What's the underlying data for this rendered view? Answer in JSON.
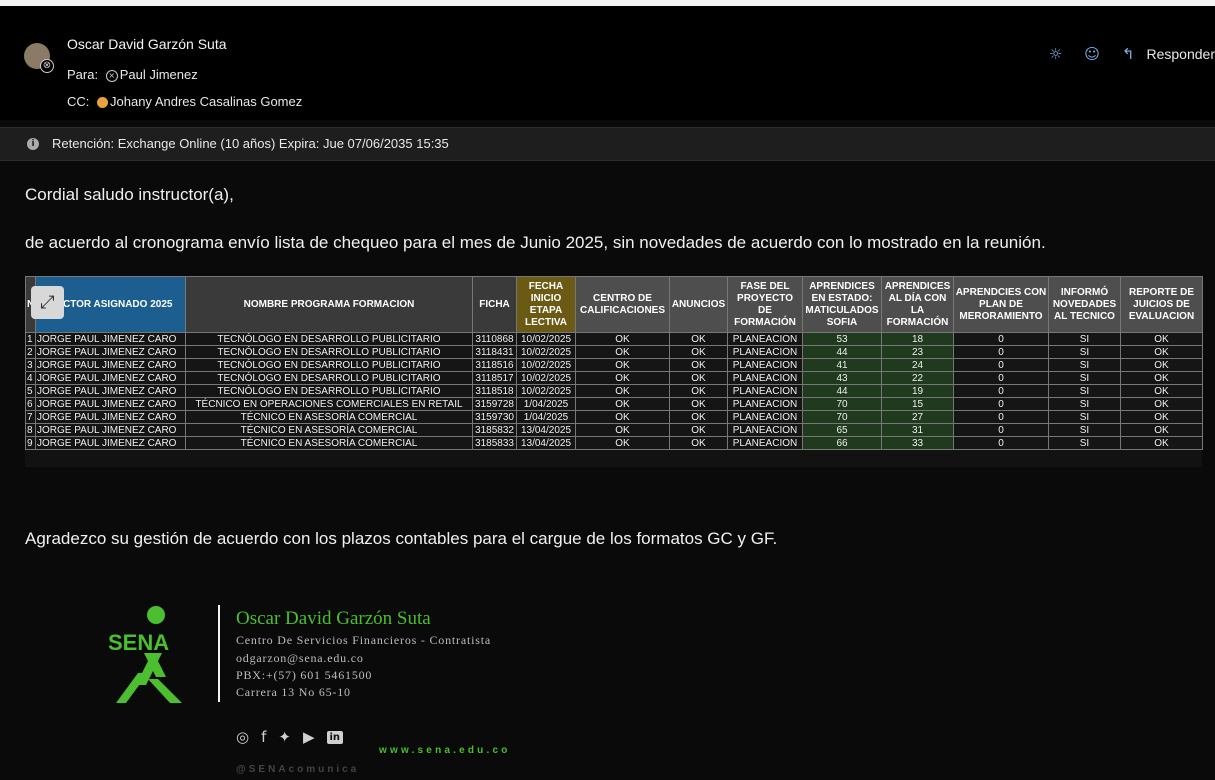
{
  "header": {
    "sender": "Oscar David Garzón Suta",
    "to_label": "Para:",
    "to_name": "Paul Jimenez",
    "cc_label": "CC:",
    "cc_name": "Johany Andres Casalinas Gomez",
    "reply_label": "Responder",
    "icons": [
      "sun-icon",
      "smiley-icon",
      "reply-arrow-icon"
    ],
    "accent_color": "#7fb2e8"
  },
  "retention": {
    "text": "Retención: Exchange Online (10 años) Expira: Jue 07/06/2035 15:35"
  },
  "body": {
    "greeting": "Cordial saludo instructor(a),",
    "intro": "de acuerdo al cronograma envío lista de chequeo para el mes de Junio 2025, sin novedades de acuerdo con lo mostrado en la reunión.",
    "thanks": "Agradezco su gestión de acuerdo con los plazos contables para el cargue de los formatos GC y GF."
  },
  "table": {
    "headers": {
      "num": "N",
      "instructor": "RUCTOR ASIGNADO 2025",
      "program": "NOMBRE PROGRAMA FORMACION",
      "ficha": "FICHA",
      "fecha": "FECHA INICIO ETAPA LECTIVA",
      "centro": "CENTRO DE CALIFICACIONES",
      "anuncios": "ANUNCIOS",
      "fase": "FASE DEL PROYECTO DE FORMACIÓN",
      "matriculados": "APRENDICES EN ESTADO: MATICULADOS SOFIA",
      "aldia": "APRENDICES AL DÍA CON LA FORMACIÓN",
      "plan": "APRENDCIES CON PLAN DE MERORAMIENTO",
      "informo": "INFORMÓ NOVEDADES AL TECNICO",
      "reporte": "REPORTE DE JUICIOS DE EVALUACION"
    },
    "rows": [
      {
        "n": "1",
        "instructor": "JORGE PAUL JIMENEZ CARO",
        "program": "TECNÓLOGO EN DESARROLLO PUBLICITARIO",
        "ficha": "3110868",
        "fecha": "10/02/2025",
        "centro": "OK",
        "anuncios": "OK",
        "fase": "PLANEACION",
        "matriculados": "53",
        "aldia": "18",
        "plan": "0",
        "informo": "SI",
        "reporte": "OK"
      },
      {
        "n": "2",
        "instructor": "JORGE PAUL JIMENEZ CARO",
        "program": "TECNÓLOGO EN DESARROLLO PUBLICITARIO",
        "ficha": "3118431",
        "fecha": "10/02/2025",
        "centro": "OK",
        "anuncios": "OK",
        "fase": "PLANEACION",
        "matriculados": "44",
        "aldia": "23",
        "plan": "0",
        "informo": "SI",
        "reporte": "OK"
      },
      {
        "n": "3",
        "instructor": "JORGE PAUL JIMENEZ CARO",
        "program": "TECNÓLOGO EN DESARROLLO PUBLICITARIO",
        "ficha": "3118516",
        "fecha": "10/02/2025",
        "centro": "OK",
        "anuncios": "OK",
        "fase": "PLANEACION",
        "matriculados": "41",
        "aldia": "24",
        "plan": "0",
        "informo": "SI",
        "reporte": "OK"
      },
      {
        "n": "4",
        "instructor": "JORGE PAUL JIMENEZ CARO",
        "program": "TECNÓLOGO EN DESARROLLO PUBLICITARIO",
        "ficha": "3118517",
        "fecha": "10/02/2025",
        "centro": "OK",
        "anuncios": "OK",
        "fase": "PLANEACION",
        "matriculados": "43",
        "aldia": "22",
        "plan": "0",
        "informo": "SI",
        "reporte": "OK"
      },
      {
        "n": "5",
        "instructor": "JORGE PAUL JIMENEZ CARO",
        "program": "TECNÓLOGO EN DESARROLLO PUBLICITARIO",
        "ficha": "3118518",
        "fecha": "10/02/2025",
        "centro": "OK",
        "anuncios": "OK",
        "fase": "PLANEACION",
        "matriculados": "44",
        "aldia": "19",
        "plan": "0",
        "informo": "SI",
        "reporte": "OK"
      },
      {
        "n": "6",
        "instructor": "JORGE PAUL JIMENEZ CARO",
        "program": "TÉCNICO EN OPERACIONES COMERCIALES EN RETAIL",
        "ficha": "3159728",
        "fecha": "1/04/2025",
        "centro": "OK",
        "anuncios": "OK",
        "fase": "PLANEACION",
        "matriculados": "70",
        "aldia": "15",
        "plan": "0",
        "informo": "SI",
        "reporte": "OK"
      },
      {
        "n": "7",
        "instructor": "JORGE PAUL JIMENEZ CARO",
        "program": "TÉCNICO EN ASESORÍA COMERCIAL",
        "ficha": "3159730",
        "fecha": "1/04/2025",
        "centro": "OK",
        "anuncios": "OK",
        "fase": "PLANEACION",
        "matriculados": "70",
        "aldia": "27",
        "plan": "0",
        "informo": "SI",
        "reporte": "OK"
      },
      {
        "n": "8",
        "instructor": "JORGE PAUL JIMENEZ CARO",
        "program": "TÉCNICO EN ASESORÍA COMERCIAL",
        "ficha": "3185832",
        "fecha": "13/04/2025",
        "centro": "OK",
        "anuncios": "OK",
        "fase": "PLANEACION",
        "matriculados": "65",
        "aldia": "31",
        "plan": "0",
        "informo": "SI",
        "reporte": "OK"
      },
      {
        "n": "9",
        "instructor": "JORGE PAUL JIMENEZ CARO",
        "program": "TÉCNICO EN ASESORÍA COMERCIAL",
        "ficha": "3185833",
        "fecha": "13/04/2025",
        "centro": "OK",
        "anuncios": "OK",
        "fase": "PLANEACION",
        "matriculados": "66",
        "aldia": "33",
        "plan": "0",
        "informo": "SI",
        "reporte": "OK"
      }
    ],
    "header_colors": {
      "instructor": "#1b5e8f",
      "fecha": "#6a5a14",
      "default": "#4e4e4e"
    },
    "highlight_color": "#1f3a1c"
  },
  "signature": {
    "logo_text": "SENA",
    "name": "Oscar David Garzón Suta",
    "line1": "Centro De Servicios Financieros - Contratista",
    "line2": "odgarzon@sena.edu.co",
    "line3": "PBX:+(57) 601 5461500",
    "line4": "Carrera 13 No 65-10",
    "website": "www.sena.edu.co",
    "handle": "@SENAcomunica",
    "social_icons": [
      "instagram-icon",
      "facebook-icon",
      "twitter-icon",
      "youtube-icon",
      "linkedin-icon"
    ],
    "brand_color": "#4bbf2f"
  }
}
